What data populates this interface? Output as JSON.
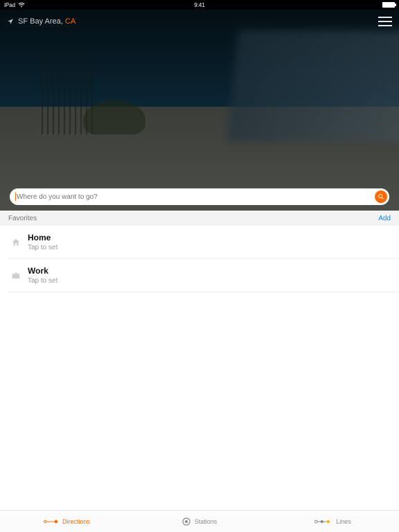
{
  "status": {
    "device": "iPad",
    "time": "9:41"
  },
  "header": {
    "location_prefix": "SF Bay Area, ",
    "location_region": "CA"
  },
  "search": {
    "placeholder": "Where do you want to go?"
  },
  "favorites": {
    "heading": "Favorites",
    "add_label": "Add",
    "items": [
      {
        "title": "Home",
        "subtitle": "Tap to set"
      },
      {
        "title": "Work",
        "subtitle": "Tap to set"
      }
    ]
  },
  "nav": {
    "directions": "Directions",
    "stations": "Stations",
    "lines": "Lines"
  }
}
